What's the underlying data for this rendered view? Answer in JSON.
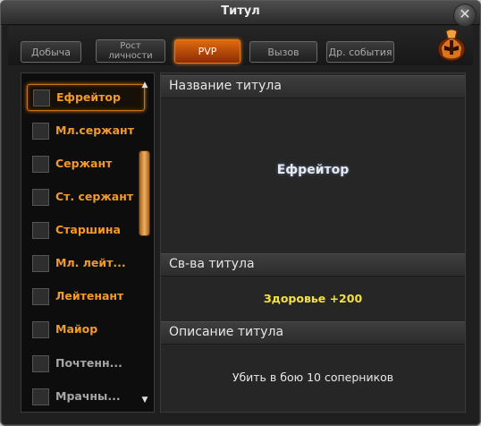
{
  "window": {
    "title": "Титул",
    "close_icon": "close-icon"
  },
  "tabs": [
    {
      "label": "Добыча",
      "active": false
    },
    {
      "label": "Рост\nличности",
      "active": false
    },
    {
      "label": "PVP",
      "active": true
    },
    {
      "label": "Вызов",
      "active": false
    },
    {
      "label": "Др. события",
      "active": false
    }
  ],
  "titles_list": {
    "items": [
      {
        "label": "Ефрейтор",
        "selected": true,
        "available": true
      },
      {
        "label": "Мл.сержант",
        "selected": false,
        "available": true
      },
      {
        "label": "Сержант",
        "selected": false,
        "available": true
      },
      {
        "label": "Ст. сержант",
        "selected": false,
        "available": true
      },
      {
        "label": "Старшина",
        "selected": false,
        "available": true
      },
      {
        "label": "Мл. лейт...",
        "selected": false,
        "available": true
      },
      {
        "label": "Лейтенант",
        "selected": false,
        "available": true
      },
      {
        "label": "Майор",
        "selected": false,
        "available": true
      },
      {
        "label": "Почтенн...",
        "selected": false,
        "available": false
      },
      {
        "label": "Мрачны...",
        "selected": false,
        "available": false
      }
    ]
  },
  "details": {
    "name_header": "Название титула",
    "name_value": "Ефрейтор",
    "props_header": "Св-ва титула",
    "props_value": "Здоровье +200",
    "desc_header": "Описание титула",
    "desc_value": "Убить в бою 10 соперников"
  },
  "colors": {
    "accent_orange": "#f39a26",
    "active_tab": "#e06a10",
    "bonus_yellow": "#f4e238"
  }
}
